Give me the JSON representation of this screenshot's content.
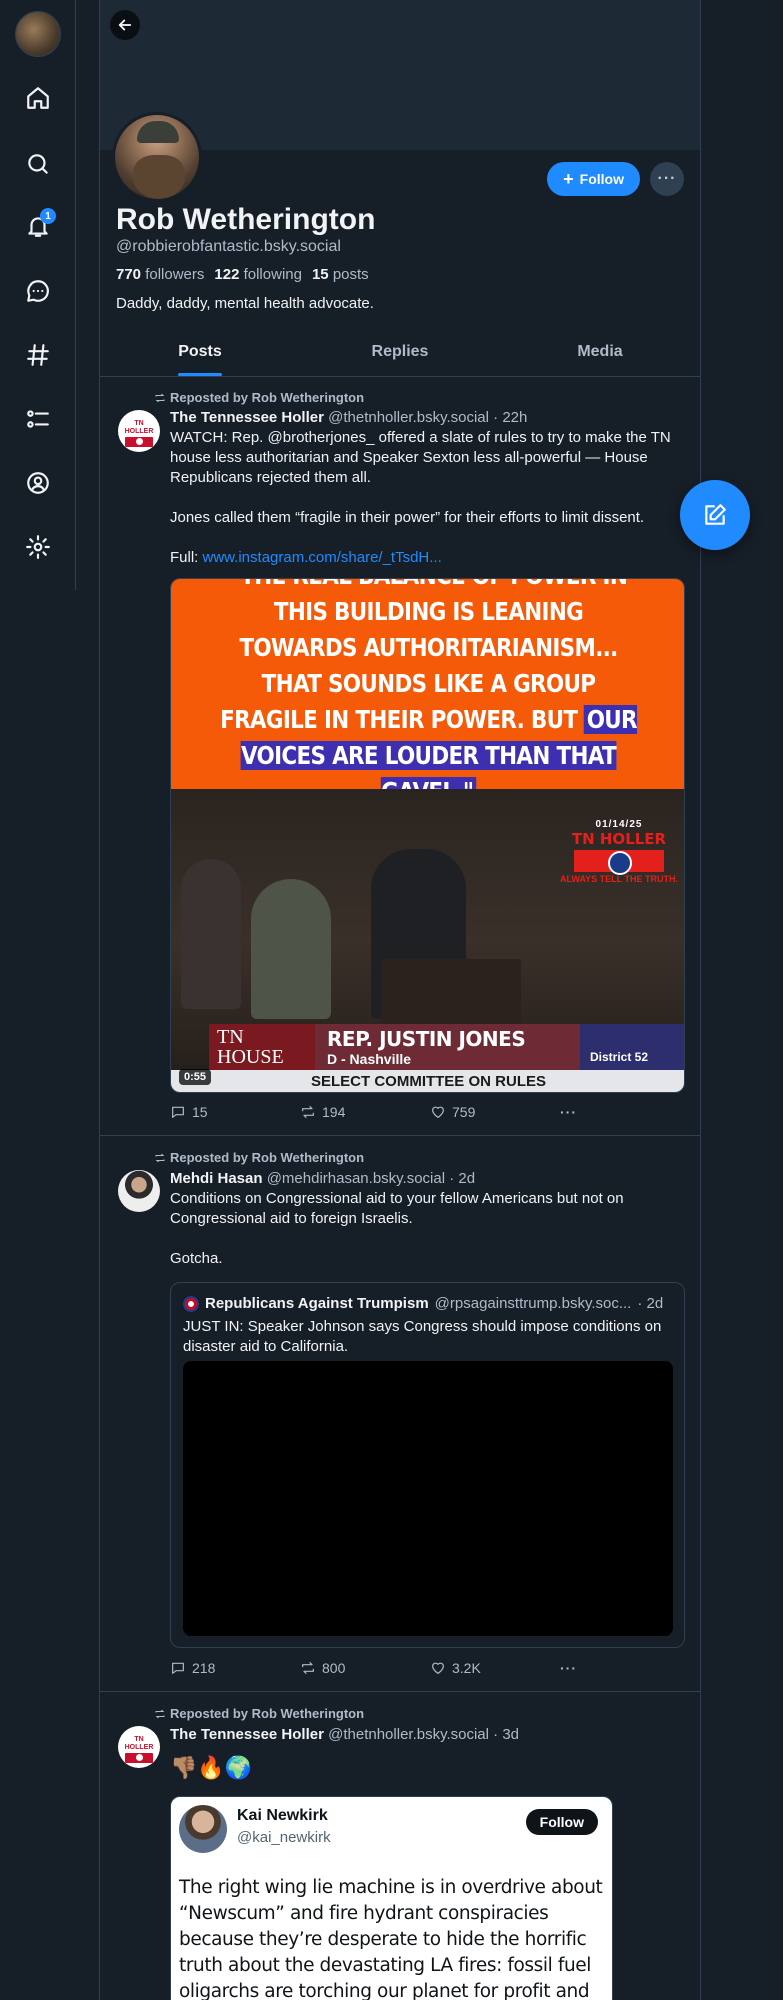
{
  "profile": {
    "display_name": "Rob Wetherington",
    "handle": "@robbierobfantastic.bsky.social",
    "followers_count": "770",
    "followers_label": "followers",
    "following_count": "122",
    "following_label": "following",
    "posts_count": "15",
    "posts_label": "posts",
    "bio": "Daddy, daddy, mental health advocate.",
    "follow_label": "Follow",
    "more_label": "···"
  },
  "sidebar": {
    "notification_count": "1",
    "items": [
      "home-icon",
      "search-icon",
      "bell-icon",
      "chat-icon",
      "hashtag-icon",
      "list-icon",
      "profile-icon",
      "gear-icon"
    ]
  },
  "tabs": [
    "Posts",
    "Replies",
    "Media"
  ],
  "posts": [
    {
      "repost_label": "Reposted by Rob Wetherington",
      "author": "The Tennessee Holler",
      "handle": "@thetnholler.bsky.social",
      "time": "· 22h",
      "text": "WATCH: Rep. @brotherjones_ offered a slate of rules to try to make the TN house less authoritarian and Speaker Sexton less all-powerful — House Republicans rejected them all.\n\nJones called them “fragile in their power” for their efforts to limit dissent.\n\nFull: ",
      "link": "www.instagram.com/share/_tTsdH...",
      "media": {
        "quote_part1": "\"THE REAL BALANCE OF POWER IN THIS BUILDING IS LEANING TOWARDS AUTHORITARIANISM... THAT SOUNDS LIKE A GROUP FRAGILE IN THEIR POWER. BUT ",
        "quote_part2": "OUR VOICES ARE LOUDER THAN THAT GAVEL.\"",
        "date": "01/14/25",
        "watermark_name": "TN HOLLER",
        "watermark_tag": "ALWAYS TELL THE TRUTH.",
        "lt_left": "TN HOUSE",
        "lt_name": "REP. JUSTIN JONES",
        "lt_district_label": "D - Nashville",
        "lt_district": "District 52",
        "lower_bar": "SELECT COMMITTEE ON RULES",
        "duration": "0:55"
      },
      "replies": "15",
      "reposts": "194",
      "likes": "759"
    },
    {
      "repost_label": "Reposted by Rob Wetherington",
      "author": "Mehdi Hasan",
      "handle": "@mehdirhasan.bsky.social",
      "time": "· 2d",
      "text": "Conditions on Congressional aid to your fellow Americans but not on Congressional aid to foreign Israelis.\n\nGotcha.",
      "quote": {
        "author": "Republicans Against Trumpism",
        "handle": "@rpsagainsttrump.bsky.soc...",
        "time": "· 2d",
        "text": "JUST IN: Speaker Johnson says Congress should impose conditions on disaster aid to California."
      },
      "replies": "218",
      "reposts": "800",
      "likes": "3.2K"
    },
    {
      "repost_label": "Reposted by Rob Wetherington",
      "author": "The Tennessee Holler",
      "handle": "@thetnholler.bsky.social",
      "time": "· 3d",
      "emojis": "👎🏽🔥🌍",
      "tweet": {
        "name": "Kai Newkirk",
        "handle": "@kai_newkirk",
        "follow_label": "Follow",
        "text": "The right wing lie machine is in overdrive about “Newscum” and fire hydrant conspiracies because they’re desperate to hide the horrific truth about the devastating LA fires: fossil fuel oligarchs are torching our planet for profit and buying politicians"
      }
    }
  ],
  "logo_text": "TN HOLLER",
  "colors": {
    "background": "#161e27",
    "accent": "#208bfe",
    "border": "#2e4052",
    "muted_text": "#aebbc9",
    "banner_orange": "#f45a08"
  }
}
